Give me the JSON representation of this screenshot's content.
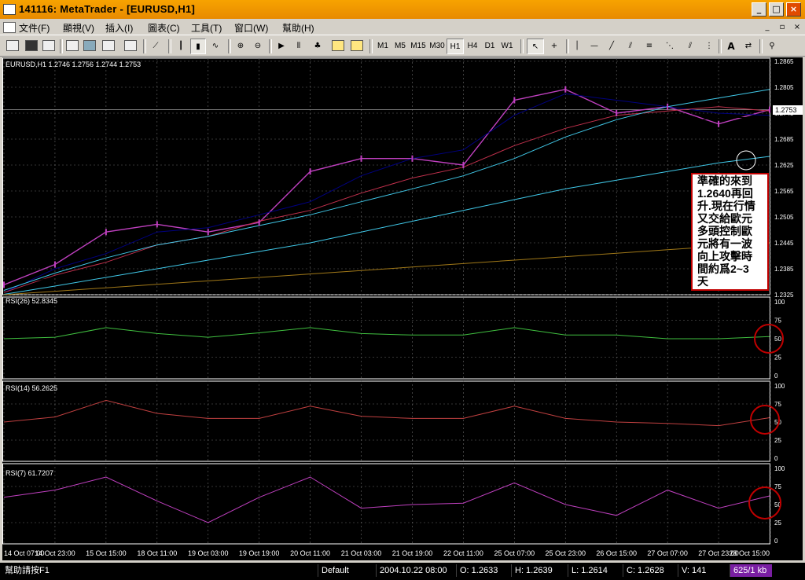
{
  "window": {
    "title": "141116: MetaTrader - [EURUSD,H1]",
    "buttons": {
      "minimize": "_",
      "restore": "□",
      "close": "×"
    }
  },
  "menu": {
    "items": [
      "文件(F)",
      "顯視(V)",
      "插入(I)",
      "圖表(C)",
      "工具(T)",
      "窗口(W)",
      "幫助(H)"
    ],
    "mdi_buttons": [
      "_",
      "▫",
      "×"
    ]
  },
  "toolbar": {
    "timeframes": [
      "M1",
      "M5",
      "M15",
      "M30",
      "H1",
      "H4",
      "D1",
      "W1"
    ],
    "selected_timeframe": "H1",
    "text_tool": "A"
  },
  "chart": {
    "main_label": "EURUSD,H1  1.2746 1.2756 1.2744 1.2753",
    "current_price": "1.2753",
    "price_ticks": [
      "1.2865",
      "1.2805",
      "1.2745",
      "1.2685",
      "1.2625",
      "1.2565",
      "1.2505",
      "1.2445",
      "1.2385",
      "1.2325"
    ],
    "annotation": "準確的來到1.2640再回升.現在行情又交給歐元多頭控制歐元將有一波向上攻擊時間約爲2~3天",
    "annotation_lines": [
      "準確的來到",
      "1.2640再回",
      "升.現在行情",
      "又交給歐元",
      "多頭控制歐",
      "元將有一波",
      "向上攻擊時",
      "間約爲2~3",
      "天"
    ],
    "rsi_panels": [
      {
        "label": "RSI(26)  52.8345",
        "ticks": [
          "100",
          "75",
          "50",
          "25",
          "0"
        ]
      },
      {
        "label": "RSI(14)  56.2625",
        "ticks": [
          "100",
          "75",
          "50",
          "25",
          "0"
        ]
      },
      {
        "label": "RSI(7)  61.7207",
        "ticks": [
          "100",
          "75",
          "50",
          "25",
          "0"
        ]
      }
    ],
    "time_ticks": [
      "14 Oct 07:00",
      "14 Oct 23:00",
      "15 Oct 15:00",
      "18 Oct 11:00",
      "19 Oct 03:00",
      "19 Oct 19:00",
      "20 Oct 11:00",
      "21 Oct 03:00",
      "21 Oct 19:00",
      "22 Oct 11:00",
      "25 Oct 07:00",
      "25 Oct 23:00",
      "26 Oct 15:00",
      "27 Oct 07:00",
      "27 Oct 23:00",
      "28 Oct 15:00"
    ]
  },
  "chart_data": {
    "type": "line",
    "title": "EURUSD,H1",
    "xlabel": "",
    "ylabel": "",
    "x": [
      "14 Oct 07:00",
      "14 Oct 23:00",
      "15 Oct 15:00",
      "18 Oct 11:00",
      "19 Oct 03:00",
      "19 Oct 19:00",
      "20 Oct 11:00",
      "21 Oct 03:00",
      "21 Oct 19:00",
      "22 Oct 11:00",
      "25 Oct 07:00",
      "25 Oct 23:00",
      "26 Oct 15:00",
      "27 Oct 07:00",
      "27 Oct 23:00",
      "28 Oct 15:00"
    ],
    "ylim": [
      1.2325,
      1.2865
    ],
    "series": [
      {
        "values": [
          1.2348,
          1.2395,
          1.247,
          1.2488,
          1.247,
          1.2492,
          1.261,
          1.264,
          1.264,
          1.2625,
          1.2775,
          1.28,
          1.2745,
          1.276,
          1.272,
          1.2753
        ]
      },
      {
        "values": [
          1.233,
          1.2385,
          1.242,
          1.247,
          1.248,
          1.251,
          1.254,
          1.26,
          1.264,
          1.266,
          1.274,
          1.279,
          1.2775,
          1.276,
          1.2745,
          1.274
        ]
      },
      {
        "values": [
          1.233,
          1.237,
          1.24,
          1.244,
          1.246,
          1.2495,
          1.252,
          1.256,
          1.2595,
          1.262,
          1.267,
          1.271,
          1.274,
          1.275,
          1.276,
          1.275
        ]
      },
      {
        "values": [
          1.2345,
          1.2365,
          1.238,
          1.24,
          1.242,
          1.245,
          1.248,
          1.251,
          1.254,
          1.257,
          1.261,
          1.265,
          1.269,
          1.272,
          1.2735,
          1.2735
        ]
      },
      {
        "values": [
          1.2335,
          1.2375,
          1.241,
          1.244,
          1.246,
          1.2485,
          1.251,
          1.254,
          1.257,
          1.26,
          1.264,
          1.269,
          1.273,
          1.276,
          1.278,
          1.28
        ]
      },
      {
        "values": [
          1.2326,
          1.2345,
          1.2365,
          1.2385,
          1.2405,
          1.2425,
          1.2445,
          1.247,
          1.2495,
          1.252,
          1.2545,
          1.257,
          1.259,
          1.261,
          1.263,
          1.2645
        ]
      },
      {
        "values": [
          1.2325,
          1.2333,
          1.2341,
          1.2349,
          1.2357,
          1.2365,
          1.2373,
          1.2381,
          1.2389,
          1.2397,
          1.2405,
          1.2413,
          1.2421,
          1.2429,
          1.2437,
          1.2445
        ]
      }
    ],
    "rsi": [
      {
        "values": [
          50,
          52,
          65,
          57,
          52,
          58,
          65,
          57,
          55,
          55,
          65,
          55,
          55,
          50,
          50,
          53
        ]
      },
      {
        "values": [
          50,
          57,
          80,
          62,
          55,
          55,
          72,
          58,
          55,
          55,
          72,
          55,
          50,
          48,
          45,
          56
        ]
      },
      {
        "values": [
          60,
          70,
          88,
          55,
          25,
          60,
          88,
          45,
          50,
          52,
          80,
          50,
          35,
          70,
          45,
          62
        ]
      }
    ],
    "colors": {
      "price": "#c040c0",
      "ma1": "#000080",
      "ma2": "#c0304c",
      "ma3": "#000000",
      "ma4": "#40c8e8",
      "ma5": "#40c8e8",
      "ma6": "#a07818",
      "rsi26": "#40c040",
      "rsi14": "#c04040",
      "rsi7": "#c040c0",
      "annotation": "#c00000"
    }
  },
  "statusbar": {
    "help": "幫助請按F1",
    "profile": "Default",
    "datetime": "2004.10.22 08:00",
    "open": "O: 1.2633",
    "high": "H: 1.2639",
    "low": "L: 1.2614",
    "close": "C: 1.2628",
    "volume": "V: 141",
    "connection": "625/1 kb"
  }
}
